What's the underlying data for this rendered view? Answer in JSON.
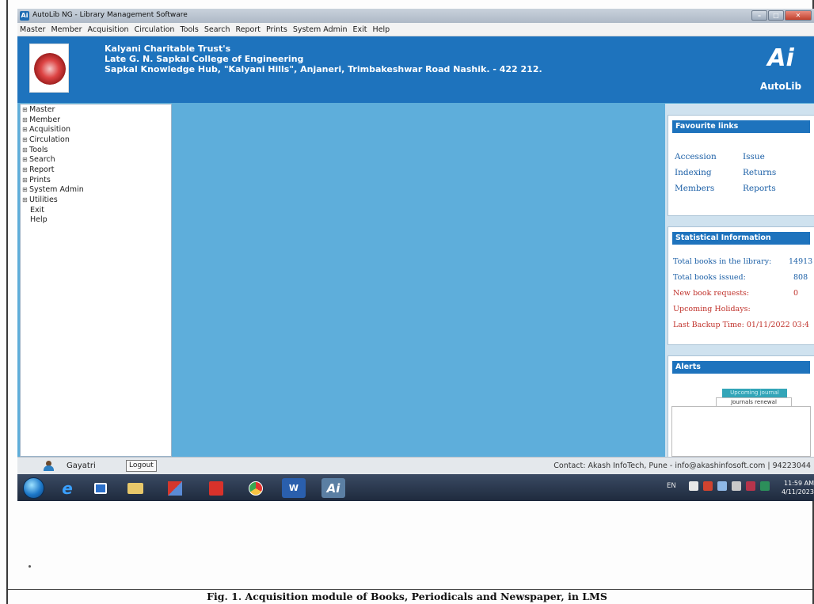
{
  "window": {
    "title": "AutoLib NG - Library Management Software",
    "app_icon_glyph": "Ai"
  },
  "menubar": [
    "Master",
    "Member",
    "Acquisition",
    "Circulation",
    "Tools",
    "Search",
    "Report",
    "Prints",
    "System Admin",
    "Exit",
    "Help"
  ],
  "header": {
    "line1": "Kalyani Charitable Trust's",
    "line2": "Late G. N. Sapkal College of Engineering",
    "line3": "Sapkal Knowledge Hub, \"Kalyani Hills\", Anjaneri, Trimbakeshwar Road Nashik. - 422 212.",
    "brand_mark": "Ai",
    "brand_name": "AutoLib",
    "bg_color": "#1e73bd"
  },
  "nav": {
    "expandable": [
      "Master",
      "Member",
      "Acquisition",
      "Circulation",
      "Tools",
      "Search",
      "Report",
      "Prints",
      "System Admin",
      "Utilities"
    ],
    "plain": [
      "Exit",
      "Help"
    ],
    "expand_glyph": "⊞"
  },
  "favourites": {
    "title": "Favourite links",
    "links": [
      "Accession",
      "Issue",
      "Indexing",
      "Returns",
      "Members",
      "Reports"
    ]
  },
  "stats": {
    "title": "Statistical Information",
    "rows": [
      {
        "label": "Total books in the library:",
        "value": "14913",
        "highlight": false
      },
      {
        "label": "Total books issued:",
        "value": "808",
        "highlight": false
      },
      {
        "label": "New book requests:",
        "value": "0",
        "highlight": true
      },
      {
        "label": "Upcoming Holidays:",
        "value": "",
        "highlight": true
      },
      {
        "label": "Last Backup Time: 01/11/2022 03:4",
        "value": "",
        "highlight": true
      }
    ]
  },
  "alerts": {
    "title": "Alerts",
    "tabs": [
      "Upcoming journal",
      "Journals renewal"
    ]
  },
  "statusbar": {
    "user": "Gayatri",
    "logout_label": "Logout",
    "contact": "Contact: Akash InfoTech, Pune - info@akashinfosoft.com | 94223044"
  },
  "taskbar": {
    "language": "EN",
    "time": "11:59 AM",
    "date": "4/11/2023",
    "pinned": [
      "internet-explorer-icon",
      "media-player-icon",
      "file-explorer-icon",
      "tool-icon",
      "acrobat-icon",
      "chrome-icon",
      "word-icon",
      "autolib-icon"
    ]
  },
  "caption": "Fig. 1. Acquisition module of Books, Periodicals and Newspaper, in LMS"
}
